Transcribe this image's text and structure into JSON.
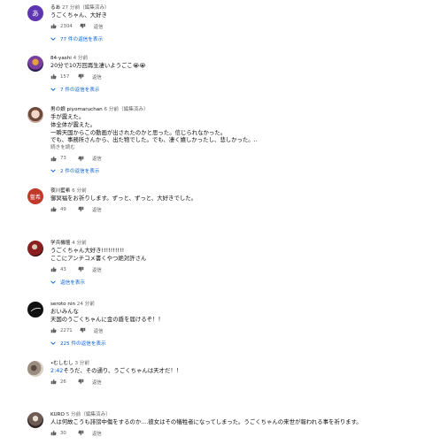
{
  "comments": [
    {
      "author": "るあ",
      "time": "27 分前",
      "edited": "（編集済み）",
      "avatar_text": "あ",
      "avatar_color": "#5e35b1",
      "lines": [
        "うごくちゃん、大好き"
      ],
      "likes": "2304",
      "reply_label": "返信",
      "replies": "77 件の返信を表示"
    },
    {
      "author": "84-yashi",
      "time": "4 分前",
      "edited": "",
      "avatar_text": "",
      "avatar_color": "#7b3fa0",
      "lines": [
        "20分で10万回再生凄いようごこ😭😭"
      ],
      "likes": "157",
      "reply_label": "返信",
      "replies": "7 件の返信を表示"
    },
    {
      "author": "男の娘 piyomaruchan",
      "time": "6 分前",
      "edited": "（編集済み）",
      "avatar_text": "",
      "avatar_color": "#c9a89b",
      "lines": [
        "手が震えた。",
        "体全体が震えた。",
        "一瞬天国からこの動画が出されたのかと思った。信じられなかった。",
        "でも、事務所さんから、出た物でした。でも、凄く嬉しかったし、悲しかった。.."
      ],
      "read_more": "続きを読む",
      "likes": "73",
      "reply_label": "返信",
      "replies": "2 件の返信を表示"
    },
    {
      "author": "夜川藍希",
      "time": "6 分前",
      "edited": "",
      "avatar_text": "藍希",
      "avatar_color": "#c0392b",
      "lines": [
        "御冥福をお祈りします。ずっと、ずっと、大好きでした。"
      ],
      "likes": "49",
      "reply_label": "返信",
      "replies": ""
    },
    {
      "author": "学兵機壇",
      "time": "4 分前",
      "edited": "",
      "avatar_text": "",
      "avatar_color": "#8b1e1e",
      "lines": [
        "うごくちゃん大好き!!!!!!!!!!",
        "ここにアンチコメ書くやつ絶対許さん"
      ],
      "likes": "43",
      "reply_label": "返信",
      "replies": "返信を表示"
    },
    {
      "author": "seroto nin",
      "time": "24 分前",
      "edited": "",
      "avatar_text": "",
      "avatar_color": "#111111",
      "lines": [
        "おいみんな",
        "天国のうごくちゃんに金の盾を届けるぞ！！"
      ],
      "likes": "2271",
      "reply_label": "返信",
      "replies": "225 件の返信を表示"
    },
    {
      "author": "•むしむし",
      "time": "3 分前",
      "edited": "",
      "avatar_text": "",
      "avatar_color": "#9a8d80",
      "timestamp_link": "2:42",
      "lines": [
        "そうだ、その通り、うごくちゃんは天才だ！！"
      ],
      "likes": "26",
      "reply_label": "返信",
      "replies": ""
    },
    {
      "author": "KURO",
      "time": "5 分前",
      "edited": "（編集済み）",
      "avatar_text": "",
      "avatar_color": "#6b5b52",
      "lines": [
        "人は何故こうも誹謗中傷をするのか....彼女はその犠牲者になってしまった。うごくちゃんの来世が報われる事を祈ります。"
      ],
      "likes": "30",
      "reply_label": "返信",
      "replies": ""
    }
  ]
}
